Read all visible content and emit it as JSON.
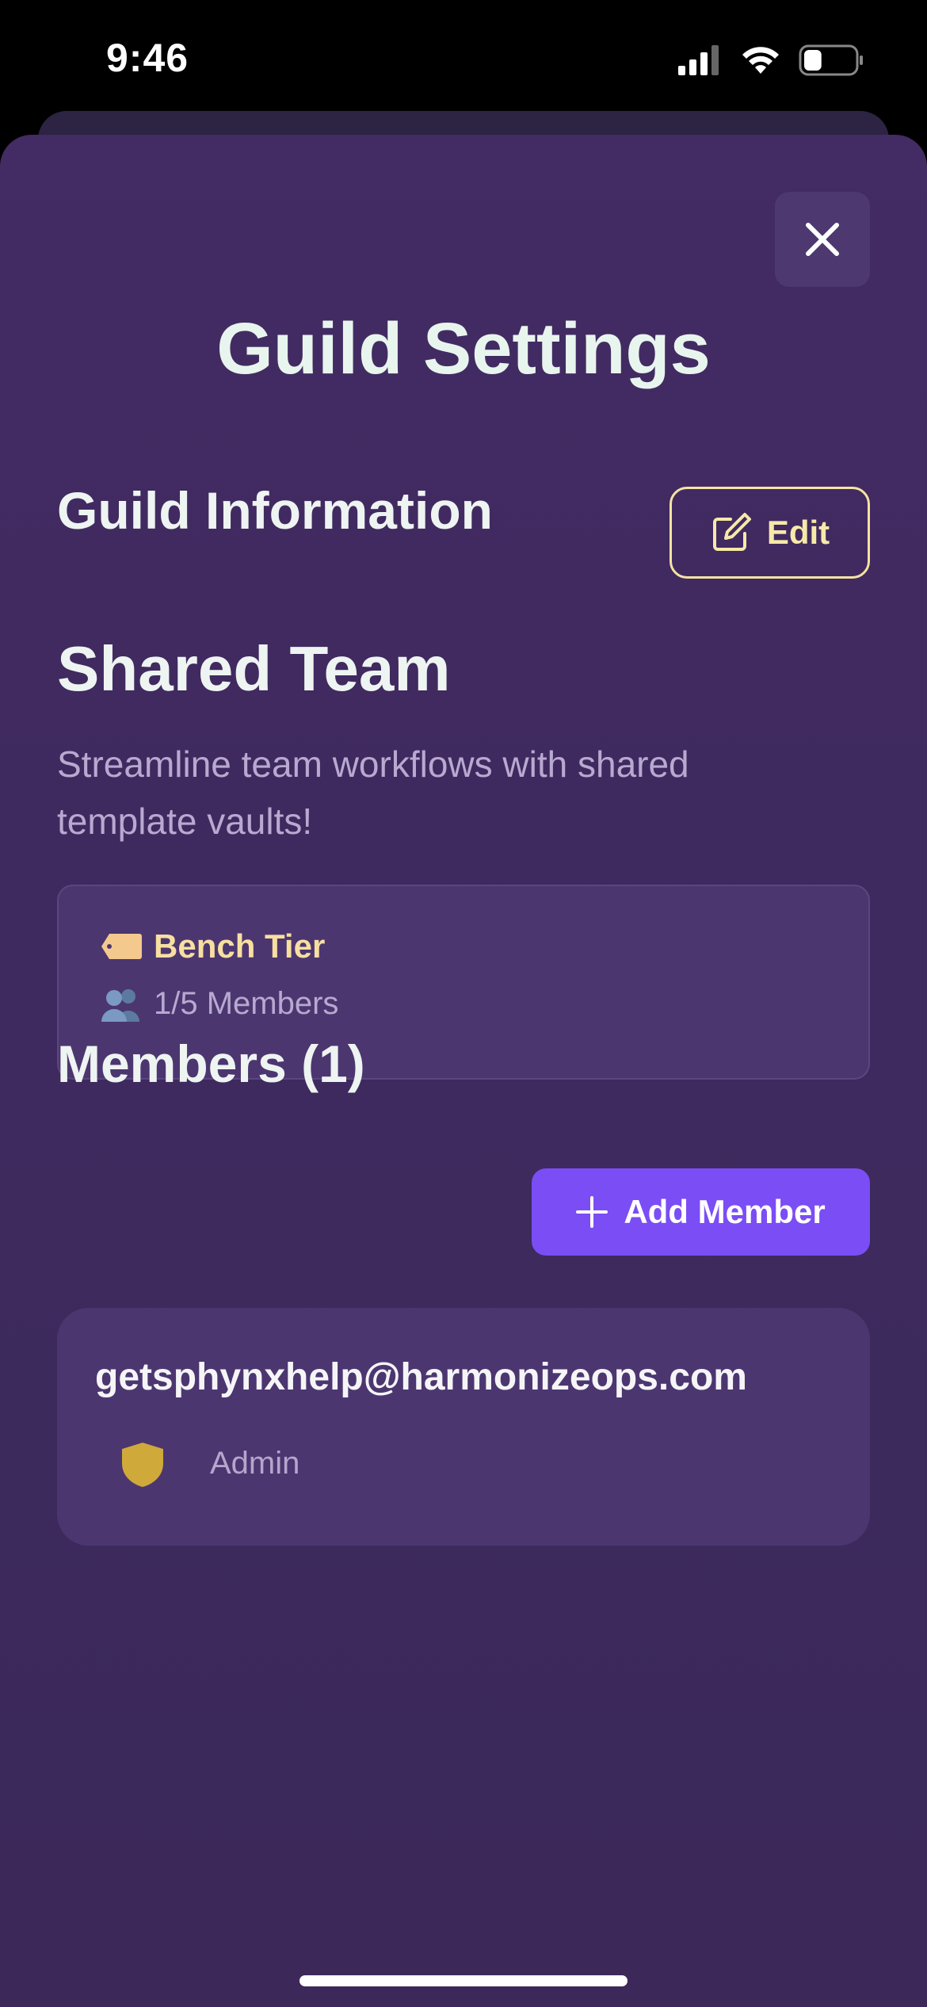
{
  "status_bar": {
    "time": "9:46",
    "battery_level": 0.35
  },
  "modal": {
    "title": "Guild Settings",
    "close_icon": "close-icon"
  },
  "guild_info": {
    "heading": "Guild Information",
    "edit_label": "Edit",
    "edit_icon": "edit-icon",
    "team_name": "Shared Team",
    "description": "Streamline team workflows with shared template vaults!",
    "tier": {
      "icon": "tag-icon",
      "label": "Bench Tier"
    },
    "members": {
      "icon": "people-icon",
      "label": "1/5 Members"
    }
  },
  "members_section": {
    "heading": "Members (1)",
    "add_label": "Add Member",
    "add_icon": "plus-icon",
    "items": [
      {
        "email": "getsphynxhelp@harmonizeops.com",
        "role": "Admin",
        "role_icon": "shield-icon"
      }
    ]
  },
  "colors": {
    "accent": "#7b4df5",
    "sheet_bg": "#3e2a5e",
    "card_bg": "#4c3670",
    "gold": "#f7e9a8",
    "shield": "#cfa93a"
  }
}
